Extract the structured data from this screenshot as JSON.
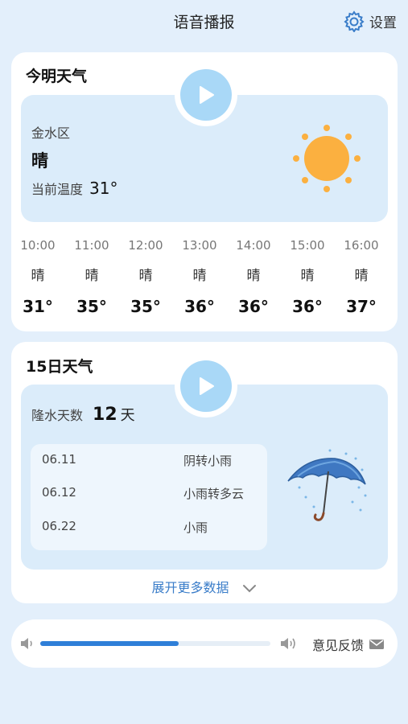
{
  "header": {
    "title": "语音播报",
    "settings_label": "设置"
  },
  "today": {
    "title": "今明天气",
    "district": "金水区",
    "condition": "晴",
    "current_temp_label": "当前温度",
    "current_temp": "31°",
    "hourly": [
      {
        "time": "10:00",
        "weather": "晴",
        "temp": "31°"
      },
      {
        "time": "11:00",
        "weather": "晴",
        "temp": "35°"
      },
      {
        "time": "12:00",
        "weather": "晴",
        "temp": "35°"
      },
      {
        "time": "13:00",
        "weather": "晴",
        "temp": "36°"
      },
      {
        "time": "14:00",
        "weather": "晴",
        "temp": "36°"
      },
      {
        "time": "15:00",
        "weather": "晴",
        "temp": "36°"
      },
      {
        "time": "16:00",
        "weather": "晴",
        "temp": "37°"
      }
    ]
  },
  "fifteen_day": {
    "title": "15日天气",
    "rain_days_label": "隆水天数",
    "rain_days_value": "12",
    "rain_days_unit": "天",
    "rows": [
      {
        "date": "06.11",
        "desc": "阴转小雨"
      },
      {
        "date": "06.12",
        "desc": "小雨转多云"
      },
      {
        "date": "06.22",
        "desc": "小雨"
      }
    ],
    "expand_label": "展开更多数据"
  },
  "player": {
    "progress": 0.6,
    "feedback_label": "意见反馈"
  },
  "colors": {
    "accent": "#2f7fd8",
    "sun": "#fbb040",
    "panel": "#dbecfa",
    "play": "#a9d8f7"
  }
}
